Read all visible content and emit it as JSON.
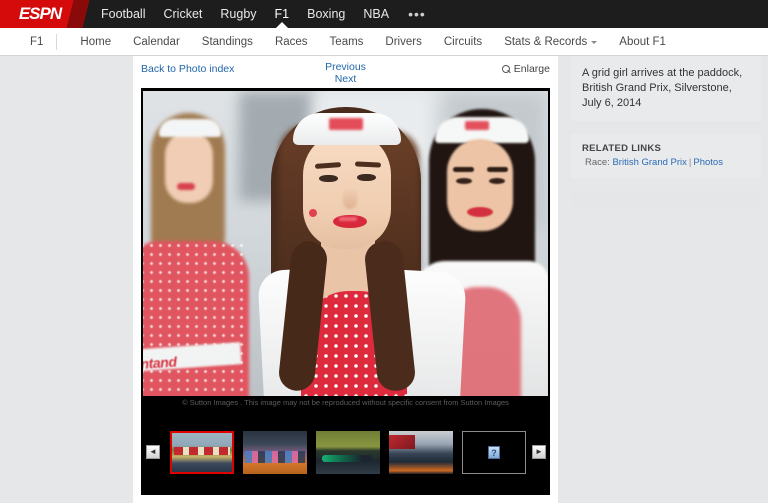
{
  "topnav": {
    "logo": "ESPN",
    "items": [
      {
        "label": "Football",
        "active": false
      },
      {
        "label": "Cricket",
        "active": false
      },
      {
        "label": "Rugby",
        "active": false
      },
      {
        "label": "F1",
        "active": true
      },
      {
        "label": "Boxing",
        "active": false
      },
      {
        "label": "NBA",
        "active": false
      }
    ],
    "more": "•••"
  },
  "subnav": {
    "brand": "F1",
    "items": [
      {
        "label": "Home",
        "dropdown": false
      },
      {
        "label": "Calendar",
        "dropdown": false
      },
      {
        "label": "Standings",
        "dropdown": false
      },
      {
        "label": "Races",
        "dropdown": false
      },
      {
        "label": "Teams",
        "dropdown": false
      },
      {
        "label": "Drivers",
        "dropdown": false
      },
      {
        "label": "Circuits",
        "dropdown": false
      },
      {
        "label": "Stats & Records",
        "dropdown": true
      },
      {
        "label": "About F1",
        "dropdown": false
      }
    ]
  },
  "toolbar": {
    "back_label": "Back to Photo index",
    "previous_label": "Previous",
    "next_label": "Next",
    "enlarge_label": "Enlarge",
    "enlarge_icon": "magnifier-icon"
  },
  "photo": {
    "alt": "A grid girl arrives at the paddock, British Grand Prix, Silverstone",
    "watermark": "© Sutton Images . This image may not be reproduced without specific consent from Sutton Images",
    "sponsor_text": "antand"
  },
  "thumbstrip": {
    "prev_icon": "chevron-left-icon",
    "next_icon": "chevron-right-icon",
    "thumbs": [
      {
        "name": "thumb-1",
        "selected": true,
        "broken": false
      },
      {
        "name": "thumb-2",
        "selected": false,
        "broken": false
      },
      {
        "name": "thumb-3",
        "selected": false,
        "broken": false
      },
      {
        "name": "thumb-4",
        "selected": false,
        "broken": false
      },
      {
        "name": "thumb-5",
        "selected": false,
        "broken": true,
        "icon": "broken-image-icon",
        "glyph": "?"
      }
    ]
  },
  "sidebar": {
    "caption": "A grid girl arrives at the paddock, British Grand Prix, Silverstone, July 6, 2014",
    "related_title": "RELATED LINKS",
    "related_prefix": "Race:",
    "related_link_1": "British Grand Prix",
    "related_separator": "|",
    "related_link_2": "Photos"
  },
  "colors": {
    "brand_red": "#d50a0a",
    "nav_dark": "#1d1d1d",
    "link_blue": "#2266aa",
    "page_bg": "#e6e7e8",
    "panel_bg": "#e9eaec",
    "selected_thumb": "#e00000"
  }
}
